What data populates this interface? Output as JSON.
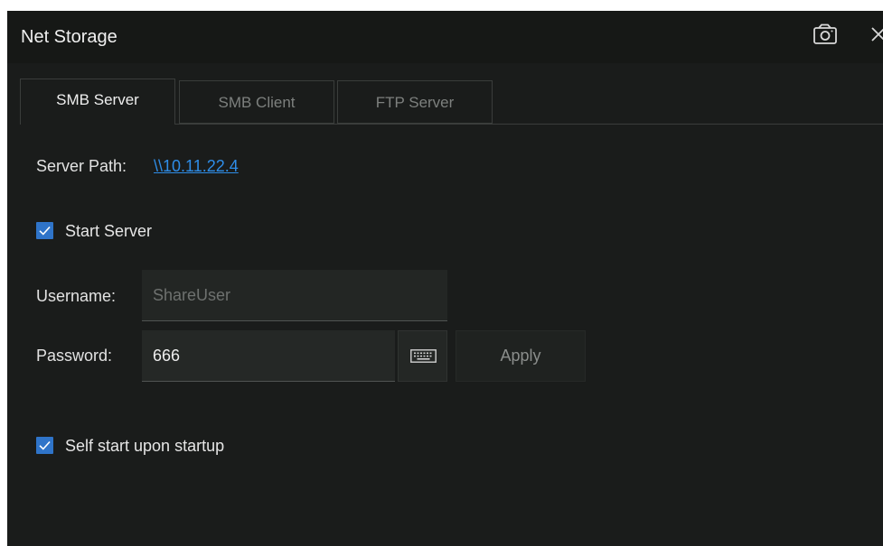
{
  "window": {
    "title": "Net Storage"
  },
  "tabs": [
    {
      "label": "SMB Server",
      "active": true
    },
    {
      "label": "SMB Client",
      "active": false
    },
    {
      "label": "FTP Server",
      "active": false
    }
  ],
  "smb_server": {
    "server_path_label": "Server Path:",
    "server_path_value": "\\\\10.11.22.4",
    "start_server": {
      "label": "Start Server",
      "checked": true
    },
    "username": {
      "label": "Username:",
      "placeholder": "ShareUser"
    },
    "password": {
      "label": "Password:",
      "value": "666"
    },
    "apply_label": "Apply",
    "self_start": {
      "label": "Self start upon startup",
      "checked": true
    }
  },
  "icons": {
    "camera": "camera-icon",
    "close": "close-icon",
    "keyboard": "keyboard-icon",
    "check": "check-icon"
  },
  "colors": {
    "background": "#1a1c1b",
    "accent": "#2f74c9",
    "link": "#2e8de8"
  }
}
